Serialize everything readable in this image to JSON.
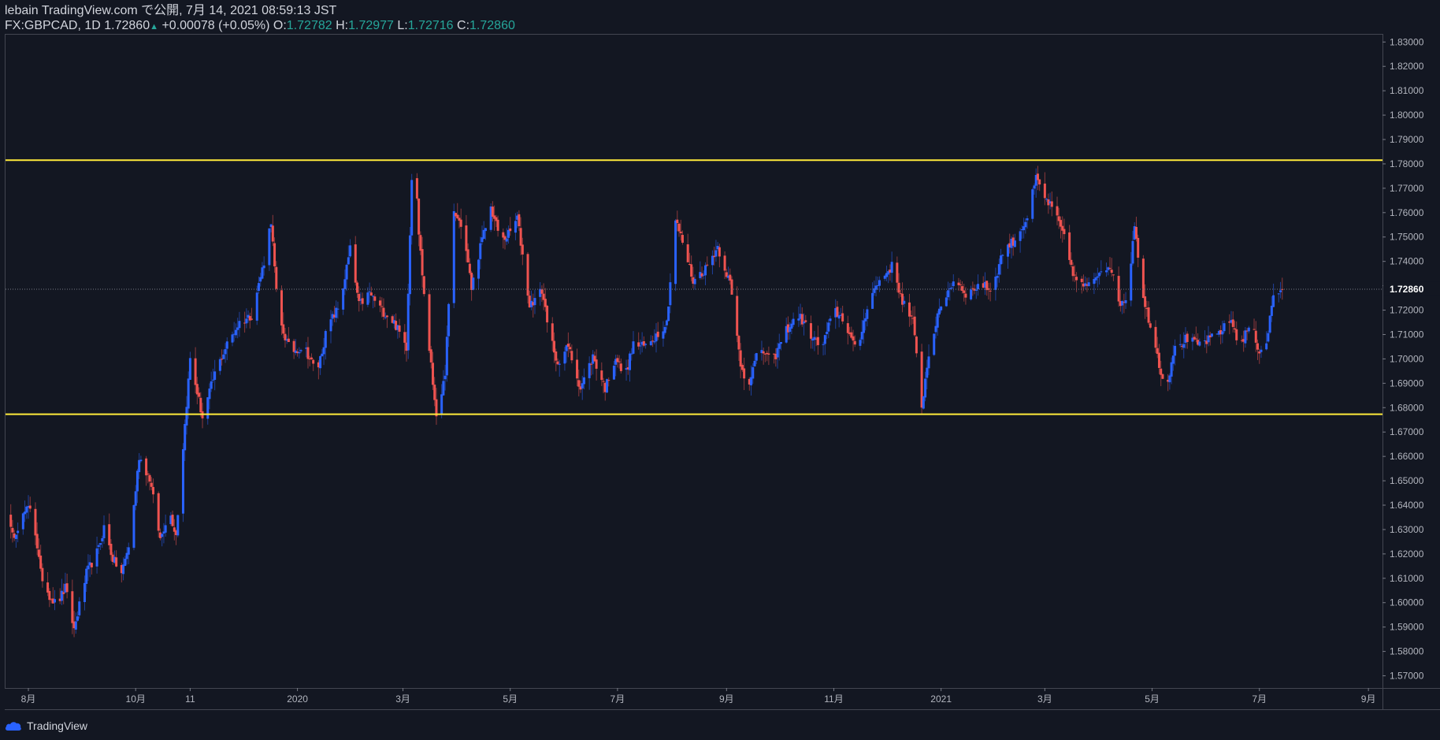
{
  "header": {
    "publish_line": "lebain TradingView.com で公開, 7月 14, 2021 08:59:13 JST",
    "symbol": "FX:GBPCAD, 1D",
    "last": "1.72860",
    "change_arrow": "▲",
    "change": "+0.00078 (+0.05%)",
    "o_label": "O:",
    "o": "1.72782",
    "h_label": "H:",
    "h": "1.72977",
    "l_label": "L:",
    "l": "1.72716",
    "c_label": "C:",
    "c": "1.72860"
  },
  "footer": {
    "brand": "TradingView",
    "logo_icon": "tradingview-cloud-logo-icon"
  },
  "colors": {
    "background": "#131722",
    "up_candle": "#2962ff",
    "down_candle": "#ef5350",
    "level_line": "#ffeb3b",
    "grid_text": "#b2b5be",
    "price_label_bg": "#131722",
    "last_price_line": "#787b86"
  },
  "chart_data": {
    "type": "candlestick",
    "symbol": "FX:GBPCAD",
    "interval": "1D",
    "ylim": [
      1.565,
      1.833
    ],
    "y_ticks": [
      "1.57000",
      "1.58000",
      "1.59000",
      "1.60000",
      "1.61000",
      "1.62000",
      "1.63000",
      "1.64000",
      "1.65000",
      "1.66000",
      "1.67000",
      "1.68000",
      "1.69000",
      "1.70000",
      "1.71000",
      "1.72000",
      "1.73000",
      "1.74000",
      "1.75000",
      "1.76000",
      "1.77000",
      "1.78000",
      "1.79000",
      "1.80000",
      "1.81000",
      "1.82000",
      "1.83000"
    ],
    "x_range": [
      "2019-07-19",
      "2021-09-09"
    ],
    "x_ticks": [
      {
        "label": "8月",
        "date": "2019-08-01"
      },
      {
        "label": "10月",
        "date": "2019-10-01"
      },
      {
        "label": "11",
        "date": "2019-11-01"
      },
      {
        "label": "2020",
        "date": "2020-01-01"
      },
      {
        "label": "3月",
        "date": "2020-03-01"
      },
      {
        "label": "5月",
        "date": "2020-05-01"
      },
      {
        "label": "7月",
        "date": "2020-07-01"
      },
      {
        "label": "9月",
        "date": "2020-09-01"
      },
      {
        "label": "11月",
        "date": "2020-11-01"
      },
      {
        "label": "2021",
        "date": "2021-01-01"
      },
      {
        "label": "3月",
        "date": "2021-03-01"
      },
      {
        "label": "5月",
        "date": "2021-05-01"
      },
      {
        "label": "7月",
        "date": "2021-07-01"
      },
      {
        "label": "9月",
        "date": "2021-09-01"
      }
    ],
    "last_price": "1.72860",
    "horizontal_levels": [
      1.7815,
      1.6773
    ],
    "close_path": [
      [
        "2019-07-19",
        1.638
      ],
      [
        "2019-07-23",
        1.627
      ],
      [
        "2019-07-30",
        1.637
      ],
      [
        "2019-08-03",
        1.64
      ],
      [
        "2019-08-08",
        1.612
      ],
      [
        "2019-08-13",
        1.603
      ],
      [
        "2019-08-17",
        1.599
      ],
      [
        "2019-08-22",
        1.606
      ],
      [
        "2019-08-27",
        1.589
      ],
      [
        "2019-09-03",
        1.612
      ],
      [
        "2019-09-10",
        1.622
      ],
      [
        "2019-09-13",
        1.631
      ],
      [
        "2019-09-18",
        1.618
      ],
      [
        "2019-09-23",
        1.612
      ],
      [
        "2019-09-28",
        1.626
      ],
      [
        "2019-10-03",
        1.66
      ],
      [
        "2019-10-09",
        1.651
      ],
      [
        "2019-10-15",
        1.626
      ],
      [
        "2019-10-20",
        1.638
      ],
      [
        "2019-10-24",
        1.628
      ],
      [
        "2019-10-28",
        1.664
      ],
      [
        "2019-11-01",
        1.7
      ],
      [
        "2019-11-08",
        1.676
      ],
      [
        "2019-11-15",
        1.694
      ],
      [
        "2019-11-22",
        1.706
      ],
      [
        "2019-11-29",
        1.715
      ],
      [
        "2019-12-06",
        1.718
      ],
      [
        "2019-12-13",
        1.74
      ],
      [
        "2019-12-17",
        1.757
      ],
      [
        "2019-12-21",
        1.717
      ],
      [
        "2019-12-28",
        1.703
      ],
      [
        "2020-01-05",
        1.705
      ],
      [
        "2020-01-12",
        1.694
      ],
      [
        "2020-01-18",
        1.713
      ],
      [
        "2020-01-25",
        1.722
      ],
      [
        "2020-01-31",
        1.745
      ],
      [
        "2020-02-05",
        1.722
      ],
      [
        "2020-02-11",
        1.727
      ],
      [
        "2020-02-18",
        1.72
      ],
      [
        "2020-02-25",
        1.715
      ],
      [
        "2020-03-03",
        1.705
      ],
      [
        "2020-03-07",
        1.798
      ],
      [
        "2020-03-10",
        1.752
      ],
      [
        "2020-03-14",
        1.718
      ],
      [
        "2020-03-18",
        1.69
      ],
      [
        "2020-03-21",
        1.672
      ],
      [
        "2020-03-25",
        1.695
      ],
      [
        "2020-03-30",
        1.76
      ],
      [
        "2020-04-04",
        1.754
      ],
      [
        "2020-04-09",
        1.729
      ],
      [
        "2020-04-14",
        1.746
      ],
      [
        "2020-04-20",
        1.762
      ],
      [
        "2020-04-26",
        1.748
      ],
      [
        "2020-05-01",
        1.752
      ],
      [
        "2020-05-05",
        1.758
      ],
      [
        "2020-05-12",
        1.722
      ],
      [
        "2020-05-19",
        1.728
      ],
      [
        "2020-05-27",
        1.698
      ],
      [
        "2020-06-03",
        1.705
      ],
      [
        "2020-06-10",
        1.688
      ],
      [
        "2020-06-17",
        1.701
      ],
      [
        "2020-06-24",
        1.688
      ],
      [
        "2020-06-30",
        1.701
      ],
      [
        "2020-07-05",
        1.692
      ],
      [
        "2020-07-10",
        1.706
      ],
      [
        "2020-07-16",
        1.705
      ],
      [
        "2020-07-22",
        1.709
      ],
      [
        "2020-07-29",
        1.715
      ],
      [
        "2020-08-03",
        1.757
      ],
      [
        "2020-08-07",
        1.748
      ],
      [
        "2020-08-13",
        1.732
      ],
      [
        "2020-08-20",
        1.737
      ],
      [
        "2020-08-27",
        1.746
      ],
      [
        "2020-09-03",
        1.731
      ],
      [
        "2020-09-09",
        1.698
      ],
      [
        "2020-09-13",
        1.689
      ],
      [
        "2020-09-20",
        1.705
      ],
      [
        "2020-09-27",
        1.698
      ],
      [
        "2020-10-04",
        1.711
      ],
      [
        "2020-10-12",
        1.718
      ],
      [
        "2020-10-19",
        1.71
      ],
      [
        "2020-10-25",
        1.704
      ],
      [
        "2020-11-01",
        1.72
      ],
      [
        "2020-11-07",
        1.716
      ],
      [
        "2020-11-14",
        1.702
      ],
      [
        "2020-11-21",
        1.725
      ],
      [
        "2020-11-28",
        1.733
      ],
      [
        "2020-12-04",
        1.738
      ],
      [
        "2020-12-10",
        1.724
      ],
      [
        "2020-12-16",
        1.715
      ],
      [
        "2020-12-21",
        1.681
      ],
      [
        "2020-12-26",
        1.707
      ],
      [
        "2021-01-02",
        1.724
      ],
      [
        "2021-01-09",
        1.733
      ],
      [
        "2021-01-16",
        1.726
      ],
      [
        "2021-01-23",
        1.731
      ],
      [
        "2021-01-30",
        1.728
      ],
      [
        "2021-02-05",
        1.744
      ],
      [
        "2021-02-12",
        1.749
      ],
      [
        "2021-02-19",
        1.758
      ],
      [
        "2021-02-24",
        1.774
      ],
      [
        "2021-03-01",
        1.766
      ],
      [
        "2021-03-05",
        1.762
      ],
      [
        "2021-03-11",
        1.752
      ],
      [
        "2021-03-18",
        1.733
      ],
      [
        "2021-03-25",
        1.729
      ],
      [
        "2021-04-01",
        1.736
      ],
      [
        "2021-04-07",
        1.739
      ],
      [
        "2021-04-12",
        1.723
      ],
      [
        "2021-04-17",
        1.725
      ],
      [
        "2021-04-21",
        1.756
      ],
      [
        "2021-04-26",
        1.724
      ],
      [
        "2021-05-01",
        1.712
      ],
      [
        "2021-05-05",
        1.698
      ],
      [
        "2021-05-09",
        1.687
      ],
      [
        "2021-05-13",
        1.703
      ],
      [
        "2021-05-20",
        1.708
      ],
      [
        "2021-05-27",
        1.706
      ],
      [
        "2021-06-03",
        1.708
      ],
      [
        "2021-06-10",
        1.712
      ],
      [
        "2021-06-15",
        1.716
      ],
      [
        "2021-06-20",
        1.705
      ],
      [
        "2021-06-26",
        1.715
      ],
      [
        "2021-07-01",
        1.703
      ],
      [
        "2021-07-05",
        1.707
      ],
      [
        "2021-07-09",
        1.726
      ],
      [
        "2021-07-14",
        1.7286
      ]
    ]
  }
}
